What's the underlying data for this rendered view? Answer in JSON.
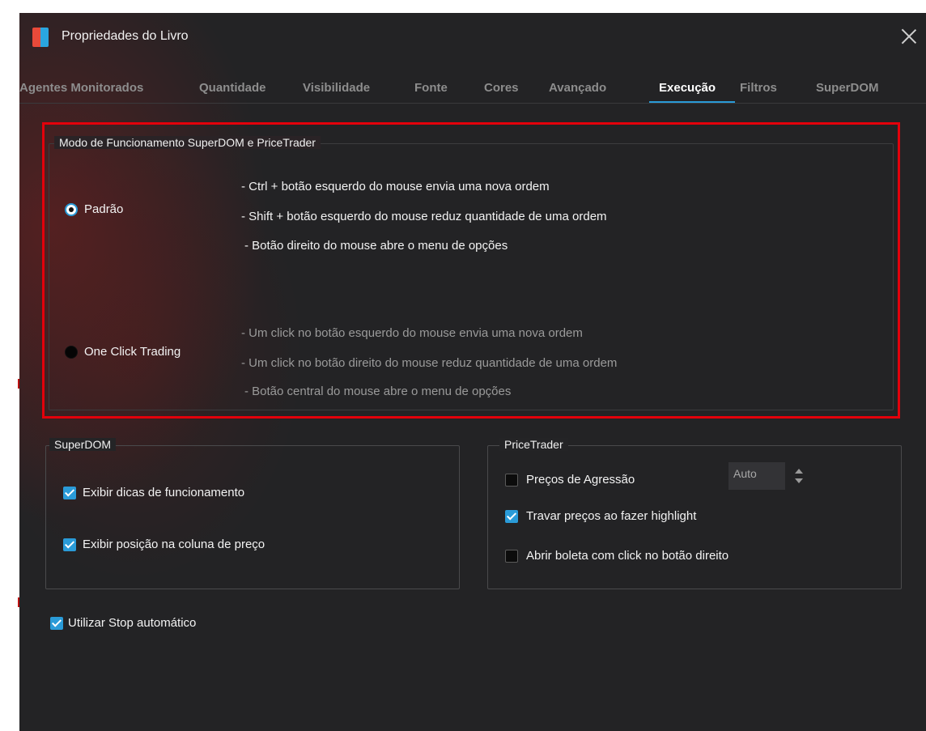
{
  "window": {
    "title": "Propriedades do Livro",
    "close_icon": "close-icon"
  },
  "tabs": [
    {
      "label": "Agentes Monitorados"
    },
    {
      "label": "Quantidade"
    },
    {
      "label": "Visibilidade"
    },
    {
      "label": "Fonte"
    },
    {
      "label": "Cores"
    },
    {
      "label": "Avançado"
    },
    {
      "label": "Execução",
      "active": true
    },
    {
      "label": "Filtros"
    },
    {
      "label": "SuperDOM"
    }
  ],
  "mode_group": {
    "title": "Modo de Funcionamento SuperDOM e PriceTrader",
    "options": [
      {
        "label": "Padrão",
        "selected": true,
        "descriptions": [
          "- Ctrl + botão esquerdo do mouse envia uma nova ordem",
          "- Shift + botão esquerdo do mouse reduz quantidade de uma ordem",
          "- Botão direito do mouse abre o menu de opções"
        ]
      },
      {
        "label": "One Click Trading",
        "selected": false,
        "descriptions": [
          "- Um click no botão esquerdo do mouse envia uma nova ordem",
          "- Um click no botão direito do mouse reduz quantidade de uma ordem",
          "- Botão central do mouse abre o menu de opções"
        ]
      }
    ]
  },
  "superdom_group": {
    "title": "SuperDOM",
    "checkboxes": [
      {
        "label": "Exibir dicas de funcionamento",
        "checked": true
      },
      {
        "label": "Exibir posição na coluna de preço",
        "checked": true
      }
    ]
  },
  "pricetrader_group": {
    "title": "PriceTrader",
    "checkboxes": [
      {
        "label": "Preços de Agressão",
        "checked": false
      },
      {
        "label": "Travar preços ao fazer highlight",
        "checked": true
      },
      {
        "label": "Abrir boleta com click no botão direito",
        "checked": false
      }
    ],
    "aggression_value": "Auto"
  },
  "auto_stop": {
    "label": "Utilizar Stop automático",
    "checked": true
  },
  "colors": {
    "accent": "#2a9bd8",
    "highlight": "#e3000b",
    "background": "#232325"
  }
}
